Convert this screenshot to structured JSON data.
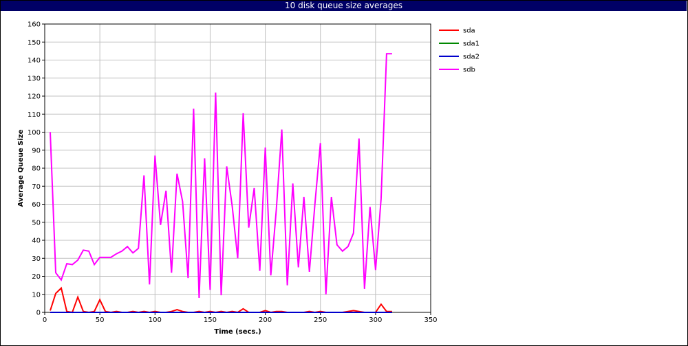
{
  "chart_data": {
    "type": "line",
    "title": "10 disk queue size averages",
    "xlabel": "Time (secs.)",
    "ylabel": "Average Queue Size",
    "xlim": [
      0,
      350
    ],
    "ylim": [
      0,
      160
    ],
    "xticks": [
      0,
      50,
      100,
      150,
      200,
      250,
      300,
      350
    ],
    "yticks": [
      0,
      10,
      20,
      30,
      40,
      50,
      60,
      70,
      80,
      90,
      100,
      110,
      120,
      130,
      140,
      150,
      160
    ],
    "grid": true,
    "legend_position": "top-right",
    "series": [
      {
        "name": "sda",
        "color": "#ff0000",
        "x": [
          5,
          10,
          15,
          20,
          25,
          30,
          35,
          40,
          45,
          50,
          55,
          60,
          65,
          70,
          75,
          80,
          85,
          90,
          95,
          100,
          105,
          110,
          115,
          120,
          125,
          130,
          135,
          140,
          145,
          150,
          155,
          160,
          165,
          170,
          175,
          180,
          185,
          190,
          195,
          200,
          205,
          210,
          215,
          220,
          225,
          230,
          235,
          240,
          245,
          250,
          255,
          260,
          265,
          270,
          275,
          280,
          285,
          290,
          295,
          300,
          305,
          310,
          315
        ],
        "values": [
          1,
          10.5,
          13.5,
          0.5,
          0,
          8.5,
          0.5,
          0,
          0.5,
          7,
          0.5,
          0,
          0.5,
          0,
          0,
          0.5,
          0,
          0.5,
          0,
          0.5,
          0,
          0,
          0.5,
          1.5,
          0.5,
          0,
          0,
          0.5,
          0,
          0.5,
          0,
          0.5,
          0,
          0.5,
          0,
          2,
          0,
          0,
          0,
          1,
          0,
          0.5,
          0.5,
          0,
          0,
          0,
          0,
          0.5,
          0,
          0.5,
          0,
          0,
          0,
          0,
          0.5,
          1,
          0.5,
          0,
          0,
          0,
          4.5,
          0.5,
          0.5
        ]
      },
      {
        "name": "sda1",
        "color": "#008800",
        "x": [
          5,
          315
        ],
        "values": [
          0,
          0
        ]
      },
      {
        "name": "sda2",
        "color": "#0000cc",
        "x": [
          5,
          315
        ],
        "values": [
          0,
          0
        ]
      },
      {
        "name": "sdb",
        "color": "#ff00ff",
        "x": [
          5,
          10,
          15,
          20,
          25,
          30,
          35,
          40,
          45,
          50,
          55,
          60,
          65,
          70,
          75,
          80,
          85,
          90,
          95,
          100,
          105,
          110,
          115,
          120,
          125,
          130,
          135,
          140,
          145,
          150,
          155,
          160,
          165,
          170,
          175,
          180,
          185,
          190,
          195,
          200,
          205,
          210,
          215,
          220,
          225,
          230,
          235,
          240,
          245,
          250,
          255,
          260,
          265,
          270,
          275,
          280,
          285,
          290,
          295,
          300,
          305,
          310,
          315
        ],
        "values": [
          100,
          22,
          18,
          27,
          26.5,
          29,
          34.5,
          34,
          26.5,
          30.5,
          30.5,
          30.5,
          32.5,
          34,
          36.5,
          33,
          35.5,
          76,
          15.5,
          87,
          48.5,
          67.5,
          22,
          77,
          61.5,
          19,
          113,
          8,
          85.5,
          12.5,
          122,
          9.5,
          81,
          59,
          30,
          110.5,
          47,
          69,
          23,
          91.5,
          20.5,
          57,
          101.5,
          15,
          71.5,
          25,
          64,
          22.5,
          60,
          94,
          10,
          64,
          37.5,
          34,
          36.5,
          44,
          96.5,
          13,
          58.5,
          23.5,
          63,
          143.5,
          143.5
        ]
      }
    ]
  }
}
